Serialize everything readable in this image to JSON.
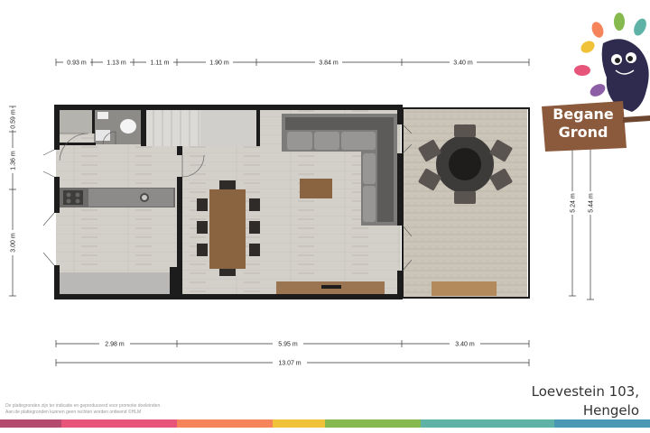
{
  "floor_label": [
    "Begane",
    "Grond"
  ],
  "address": [
    "Loevestein 103,",
    "Hengelo"
  ],
  "disclaimer": [
    "De plattegronden zijn ter indicatie en geproduceerd voor promotie doeleinden.",
    "Aan de plattegronden kunnen geen rechten worden ontleend ©HLM"
  ],
  "dimensions": {
    "top": [
      "0.93 m",
      "1.13 m",
      "1.11 m",
      "1.90 m",
      "3.84 m",
      "3.40 m"
    ],
    "bottom": [
      "2.98 m",
      "5.95 m",
      "3.40 m"
    ],
    "total": "13.07 m",
    "left": [
      "0.59 m",
      "1.36 m",
      "3.00 m"
    ],
    "right": [
      "5.24 m",
      "5.44 m"
    ]
  },
  "colors": {
    "footer_bar": [
      "#b44a6e",
      "#e7567a",
      "#f5845a",
      "#f0c23a",
      "#86b94e",
      "#5fb3a6",
      "#4b98b5",
      "#8c5ea6"
    ],
    "wall": "#1c1c1c",
    "floor": "#d2cec8",
    "terrace": "#c8c2b6",
    "sign": "#8b5a3c"
  }
}
